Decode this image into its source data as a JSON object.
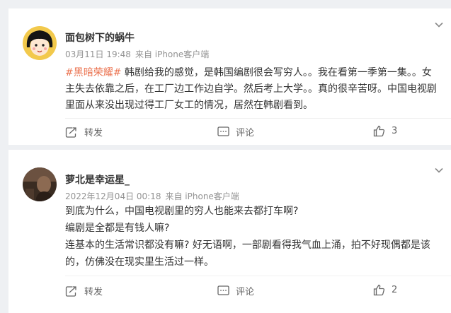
{
  "comments": [
    {
      "username": "面包树下的蜗牛",
      "date": "03月11日 19:48",
      "source": "来自 iPhone客户端",
      "hashtag": "#黑暗荣耀#",
      "text": " 韩剧给我的感觉，是韩国编剧很会写穷人。。我在看第一季第一集。。女主失去依靠之后，在工厂边工作边自学。然后考上大学。。真的很辛苦呀。中国电视剧里面从来没出现过得工厂女工的情况，居然在韩剧看到。",
      "repost_label": "转发",
      "comment_label": "评论",
      "like_count": "3",
      "avatar_icon": "cartoon-girl-avatar"
    },
    {
      "username": "萝北是幸运星_",
      "date": "2022年12月04日 00:18",
      "source": "来自 iPhone客户端",
      "paragraphs": [
        "到底为什么，中国电视剧里的穷人也能来去都打车啊?",
        "编剧是全都是有钱人嘛?",
        "连基本的生活常识都没有嘛? 好无语啊，一部剧看得我气血上涌，拍不好现偶都是该的，仿佛没在现实里生活过一样。"
      ],
      "repost_label": "转发",
      "comment_label": "评论",
      "like_count": "2",
      "avatar_icon": "photo-avatar"
    }
  ],
  "colors": {
    "hashtag": "#eb7350",
    "meta": "#939393",
    "background": "#eef0f3"
  }
}
